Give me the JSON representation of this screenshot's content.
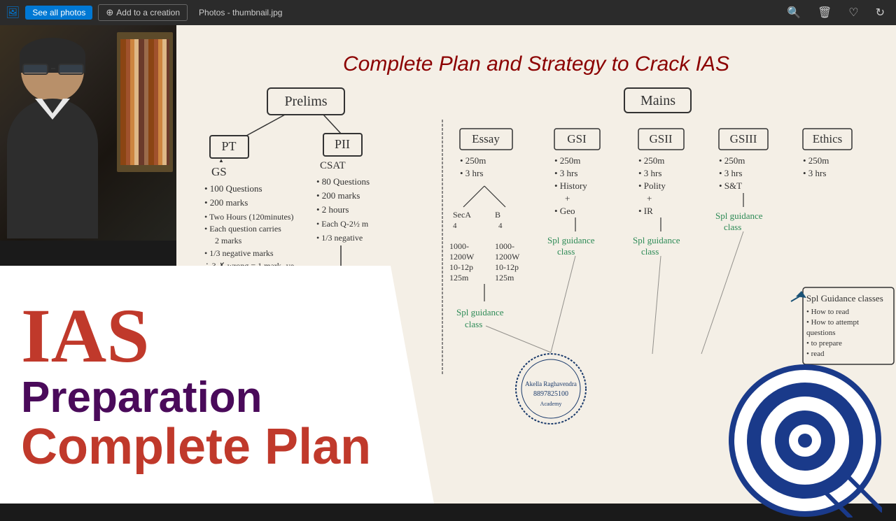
{
  "topbar": {
    "title": "Photos - thumbnail.jpg",
    "see_all_photos": "See all photos",
    "add_to_creation": "Add to a creation"
  },
  "overlay": {
    "ias_label": "IAS",
    "preparation_label": "Preparation",
    "complete_plan_label": "Complete Plan"
  },
  "whiteboard": {
    "title": "Complete Plan and Strategy to Crack IAS",
    "prelims": "Prelims",
    "mains": "Mains",
    "pt_label": "PT",
    "gs_label": "GS",
    "pii_label": "PII",
    "csat_label": "CSAT",
    "crack_word": "Crack"
  }
}
